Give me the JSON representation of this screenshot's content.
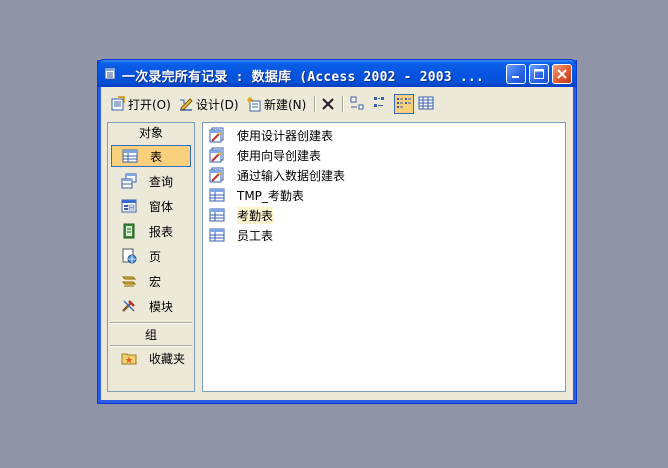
{
  "window": {
    "title": "一次录完所有记录 : 数据库 (Access 2002 - 2003 ..."
  },
  "toolbar": {
    "open_label": "打开(O)",
    "design_label": "设计(D)",
    "new_label": "新建(N)"
  },
  "objects_bar": {
    "objects_header": "对象",
    "items": [
      {
        "label": "表",
        "icon": "table-icon",
        "selected": true
      },
      {
        "label": "查询",
        "icon": "query-icon"
      },
      {
        "label": "窗体",
        "icon": "form-icon"
      },
      {
        "label": "报表",
        "icon": "report-icon"
      },
      {
        "label": "页",
        "icon": "page-icon"
      },
      {
        "label": "宏",
        "icon": "macro-icon"
      },
      {
        "label": "模块",
        "icon": "module-icon"
      }
    ],
    "groups_header": "组",
    "group_items": [
      {
        "label": "收藏夹",
        "icon": "favorites-folder-icon"
      }
    ]
  },
  "list": {
    "items": [
      {
        "label": "使用设计器创建表",
        "icon": "wizard-icon"
      },
      {
        "label": "使用向导创建表",
        "icon": "wizard-icon"
      },
      {
        "label": "通过输入数据创建表",
        "icon": "wizard-icon"
      },
      {
        "label": "TMP_考勤表",
        "icon": "table-icon"
      },
      {
        "label": "考勤表",
        "icon": "table-icon",
        "highlighted": true
      },
      {
        "label": "员工表",
        "icon": "table-icon"
      }
    ]
  },
  "colors": {
    "desktop": "#8f95a6",
    "titlebar": "#0654e0",
    "selection": "#f8cf7a",
    "selection_border": "#316ac5"
  }
}
